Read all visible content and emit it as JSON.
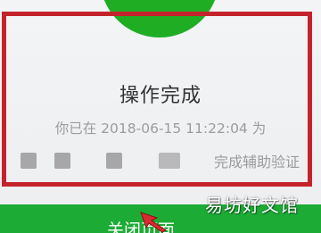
{
  "dialog": {
    "title": "操作完成",
    "line1": "你已在 2018-06-15 11:22:04 为",
    "line2_suffix": "完成辅助验证"
  },
  "close_button": {
    "label": "关闭页面"
  },
  "watermark": {
    "text": "易坊好文馆"
  },
  "colors": {
    "success_green": "#1fad24",
    "button_green": "#1cab35",
    "highlight_red": "#c4232c"
  },
  "icons": {
    "success": "success-circle-icon",
    "pointer": "red-arrow-icon"
  }
}
